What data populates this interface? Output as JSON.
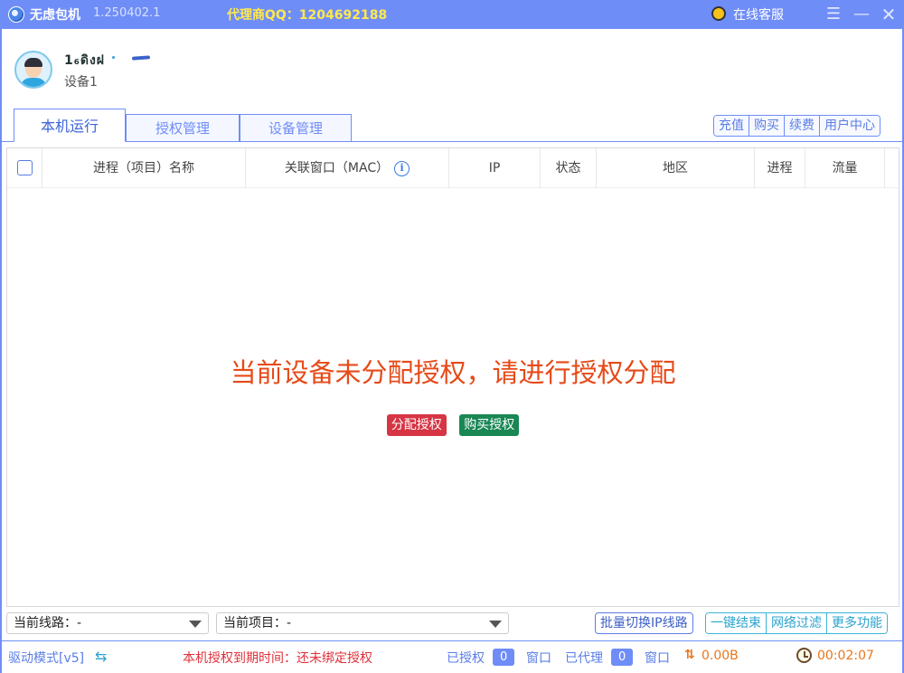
{
  "window": {
    "app_name": "无虑包机",
    "version": "1.250402.1",
    "agent_qq": "代理商QQ：1204692188",
    "support": "在线客服",
    "menu_icon": "menu-icon",
    "minimize_icon": "minimize-icon",
    "close_icon": "close-icon"
  },
  "user": {
    "name": "1₆ดิงฝ",
    "device": "设备1"
  },
  "tabs": [
    {
      "label": "本机运行",
      "active": true
    },
    {
      "label": "授权管理",
      "active": false
    },
    {
      "label": "设备管理",
      "active": false
    }
  ],
  "top_actions": [
    "充值",
    "购买",
    "续费",
    "用户中心"
  ],
  "table": {
    "columns": [
      "进程（项目）名称",
      "关联窗口（MAC）",
      "IP",
      "状态",
      "地区",
      "进程",
      "流量"
    ],
    "rows": []
  },
  "empty_state": {
    "message": "当前设备未分配授权，请进行授权分配",
    "assign_button": "分配授权",
    "buy_button": "购买授权"
  },
  "toolbar": {
    "line_select": "当前线路：-",
    "project_select": "当前项目：-",
    "switch_ip": "批量切换IP线路",
    "tools": [
      "一键结束",
      "网络过滤",
      "更多功能"
    ]
  },
  "status": {
    "driver_mode": "驱动模式[v5]",
    "expire": "本机授权到期时间：还未绑定授权",
    "authorized_label": "已授权",
    "authorized_count": "0",
    "window_label_1": "窗口",
    "proxied_label": "已代理",
    "proxied_count": "0",
    "window_label_2": "窗口",
    "traffic": "0.00B",
    "timer": "00:02:07"
  },
  "colors": {
    "accent": "#6f8df7",
    "danger": "#d63544",
    "success": "#198754",
    "warning_text": "#e64a19"
  }
}
